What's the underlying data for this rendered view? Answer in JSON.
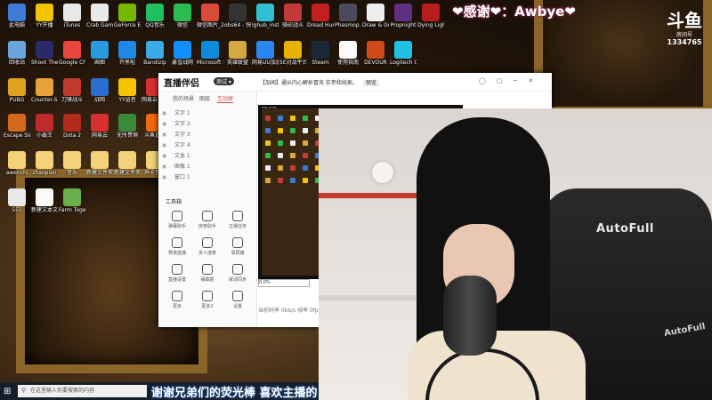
{
  "overlay": {
    "chat_text": "❤感谢❤：Awbye❤",
    "platform_logo": "斗鱼",
    "room_label": "房间号",
    "room_number": "1334765"
  },
  "desktop_icons": [
    {
      "label": "此电脑",
      "color": "#3d7bd6"
    },
    {
      "label": "YY开播",
      "color": "#f3c400"
    },
    {
      "label": "iTunes",
      "color": "#e8e8e8"
    },
    {
      "label": "Crab Game",
      "color": "#eaeaea"
    },
    {
      "label": "GeForce Experience",
      "color": "#76b900"
    },
    {
      "label": "QQ音乐",
      "color": "#20c060"
    },
    {
      "label": "微信",
      "color": "#2bbb4f"
    },
    {
      "label": "微信图片_2021111...",
      "color": "#d94a3a"
    },
    {
      "label": "obs64 - 快捷方式",
      "color": "#333"
    },
    {
      "label": "lghub_inst...",
      "color": "#30c0d0"
    },
    {
      "label": "骑砍战斗",
      "color": "#c23a3a"
    },
    {
      "label": "Dread Hunger",
      "color": "#c02020"
    },
    {
      "label": "Phasmop...",
      "color": "#4a4a5a"
    },
    {
      "label": "Draw & Guess",
      "color": "#eeeeee"
    },
    {
      "label": "Propnight",
      "color": "#603080"
    },
    {
      "label": "Dying Light 2",
      "color": "#b81c1c"
    },
    {
      "label": "回收站",
      "color": "#6aa6dc"
    },
    {
      "label": "Shoot The Wire Sour...",
      "color": "#2a2a6a"
    },
    {
      "label": "Google Chrome",
      "color": "#e8453c"
    },
    {
      "label": "画图",
      "color": "#2a9adf"
    },
    {
      "label": "开黑啦",
      "color": "#1e88e5"
    },
    {
      "label": "Bandizip",
      "color": "#3caae6"
    },
    {
      "label": "暴雪战网",
      "color": "#148eff"
    },
    {
      "label": "Microsoft Edge",
      "color": "#0f8ad8"
    },
    {
      "label": "英雄联盟",
      "color": "#d4a940"
    },
    {
      "label": "网易UU加速器",
      "color": "#2a86f0"
    },
    {
      "label": "5E对战平台",
      "color": "#e6b400"
    },
    {
      "label": "Steam",
      "color": "#1b2838"
    },
    {
      "label": "使用指南",
      "color": "#fafafa"
    },
    {
      "label": "DEVOUR",
      "color": "#d04a1c"
    },
    {
      "label": "Logitech G HUB",
      "color": "#20c0e0"
    },
    {
      "label": "PUBG",
      "color": "#e0a020"
    },
    {
      "label": "Counter-Strike Global Off...",
      "color": "#e8a13a"
    },
    {
      "label": "刀锋战斗",
      "color": "#c0392b"
    },
    {
      "label": "战网",
      "color": "#2a6ed0"
    },
    {
      "label": "YY语音",
      "color": "#f4c400"
    },
    {
      "label": "网易云音乐",
      "color": "#d63030"
    },
    {
      "label": "Escape Simulator",
      "color": "#d66a1c"
    },
    {
      "label": "小霸王",
      "color": "#c02a2a"
    },
    {
      "label": "Dota 2",
      "color": "#b32a1c"
    },
    {
      "label": "网易云",
      "color": "#d63030"
    },
    {
      "label": "无所畏惧",
      "color": "#3a8a3a"
    },
    {
      "label": "斗鱼直播",
      "color": "#f06a0a"
    },
    {
      "label": "awenchi",
      "color": "#f4d27a"
    },
    {
      "label": "zhaopian",
      "color": "#f4d27a"
    },
    {
      "label": "音乐",
      "color": "#f4d27a"
    },
    {
      "label": "新建文件夹",
      "color": "#f4d27a"
    },
    {
      "label": "新建文件夹",
      "color": "#f4d27a"
    },
    {
      "label": "声卡音效",
      "color": "#f4d27a"
    },
    {
      "label": "551",
      "color": "#e8e8e8"
    },
    {
      "label": "新建文本文档 (3)",
      "color": "#fafafa"
    },
    {
      "label": "Farm Together",
      "color": "#6ab04c"
    }
  ],
  "app": {
    "logo_text": "直播伴侣",
    "version": "测试 ▾",
    "notice": "【加闻】通从内心解析冒充 实参和线索。",
    "notice_btn": "预览",
    "window_controls": "◯ ▢ ─ ✕",
    "tabs": [
      "我的场景",
      "图层",
      "互动屏"
    ],
    "active_tab": 2,
    "scenes": [
      "文字 1",
      "文字 2",
      "文字 3",
      "文字 4",
      "文本 1",
      "图像 1",
      "窗口 1"
    ],
    "tools_title": "工具箱",
    "tools": [
      {
        "label": "弹幕助手"
      },
      {
        "label": "房管助手"
      },
      {
        "label": "主播任务"
      },
      {
        "label": "预演直播"
      },
      {
        "label": "多人连麦"
      },
      {
        "label": "录屏播"
      },
      {
        "label": "直播设置"
      },
      {
        "label": "弹幕姬"
      },
      {
        "label": "歌词同步"
      },
      {
        "label": "更多"
      },
      {
        "label": "更多2"
      },
      {
        "label": "设置"
      }
    ],
    "preview_tab": "CS:GO",
    "preview_input": "0.0%",
    "bottom_status": "当前码率 0kb/s  帧率 0fps  CPU 0%  直播时长 00:00:00"
  },
  "taskbar": {
    "search_placeholder": "在这里输入你要搜索的内容",
    "subtitle": "谢谢兄弟们的荧光棒 喜欢主播的"
  },
  "webcam": {
    "chair_brand": "AutoFull",
    "chair_brand_lower": "AutoFull"
  }
}
